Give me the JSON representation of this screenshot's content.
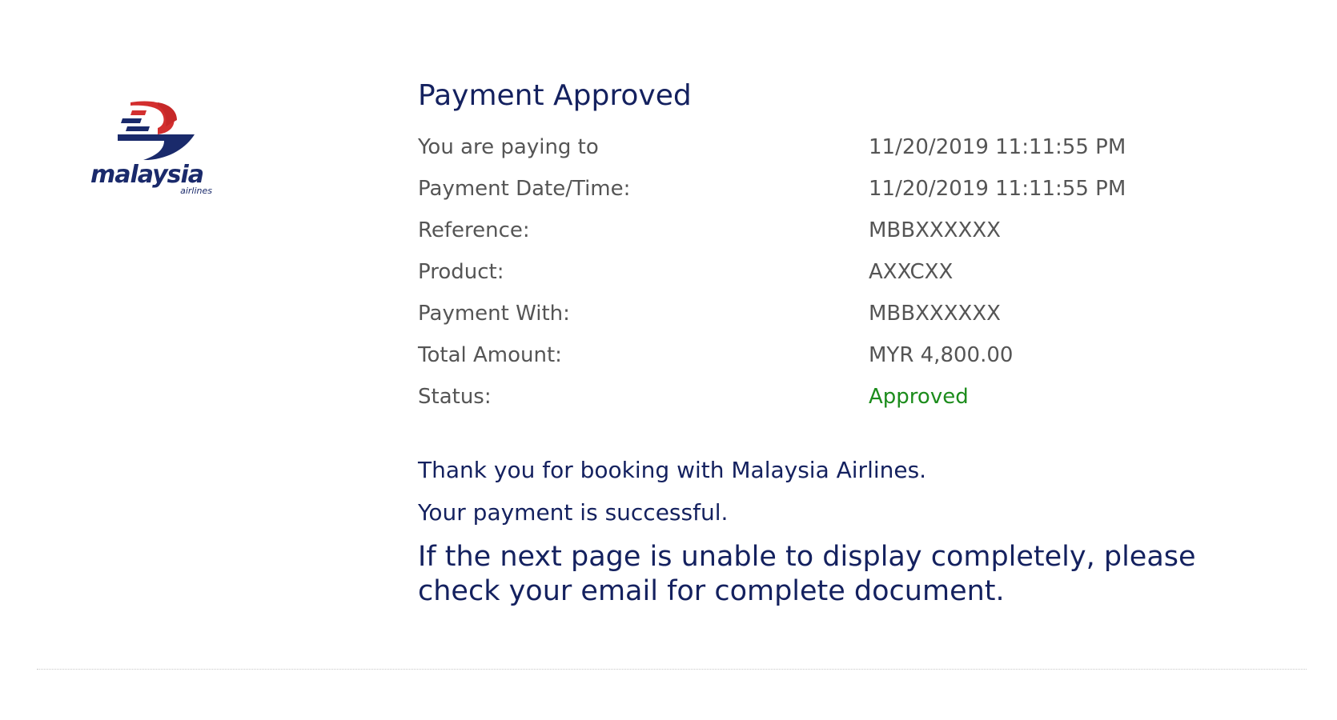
{
  "brand": {
    "name": "malaysia",
    "subname": "airlines",
    "colors": {
      "navy": "#1a2a6b",
      "red": "#d32f2f"
    },
    "icon": "malaysia-airlines-kite-logo"
  },
  "title": "Payment Approved",
  "details": {
    "rows": [
      {
        "label": "You are paying to",
        "value": "11/20/2019 11:11:55 PM"
      },
      {
        "label": "Payment Date/Time:",
        "value": "11/20/2019 11:11:55 PM"
      },
      {
        "label": "Reference:",
        "value": "MBBXXXXXX"
      },
      {
        "label": "Product:",
        "value": "AXXCXX"
      },
      {
        "label": "Payment With:",
        "value": "MBBXXXXXX"
      },
      {
        "label": "Total Amount:",
        "value": "MYR 4,800.00"
      },
      {
        "label": "Status:",
        "value": "Approved"
      }
    ],
    "status_color": "#1c8c1c"
  },
  "messages": {
    "thank_you": "Thank you for booking with Malaysia Airlines.",
    "success": "Your payment is successful.",
    "notice": "If the next page is unable to display completely, please check your email for complete document."
  },
  "colors": {
    "heading_text": "#14215f",
    "label_text": "#555555"
  }
}
